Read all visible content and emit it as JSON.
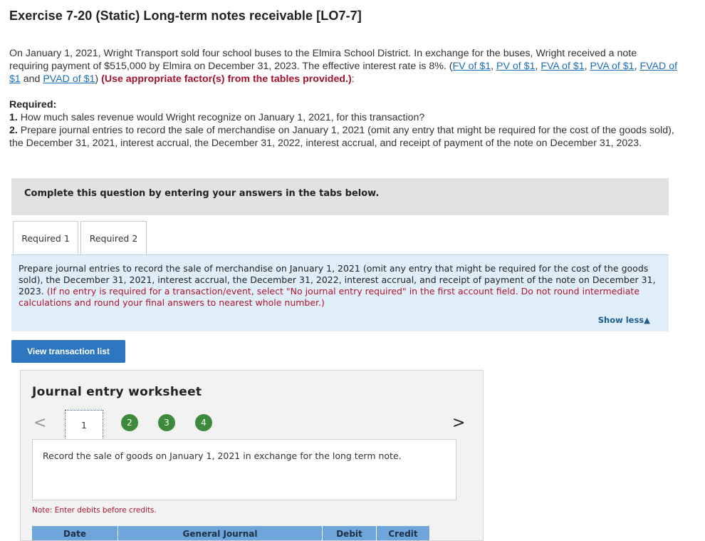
{
  "title": "Exercise 7-20 (Static) Long-term notes receivable [LO7-7]",
  "intro": {
    "text": "On January 1, 2021, Wright Transport sold four school buses to the Elmira School District. In exchange for the buses, Wright received a note requiring payment of $515,000 by Elmira on December 31, 2023. The effective interest rate is 8%. (",
    "links": [
      "FV of $1",
      "PV of $1",
      "FVA of $1",
      "PVA of $1",
      "FVAD of $1",
      "PVAD of $1"
    ],
    "sep_comma": ", ",
    "sep_and": " and ",
    "close_paren": ") ",
    "bold_red": "(Use appropriate factor(s) from the tables provided.)",
    "colon": ":"
  },
  "required": {
    "heading": "Required:",
    "item1_num": "1.",
    "item1": " How much sales revenue would Wright recognize on January 1, 2021, for this transaction?",
    "item2_num": "2.",
    "item2": " Prepare journal entries to record the sale of merchandise on January 1, 2021 (omit any entry that might be required for the cost of the goods sold), the December 31, 2021, interest accrual, the December 31, 2022, interest accrual, and receipt of payment of the note on December 31, 2023."
  },
  "banner": "Complete this question by entering your answers in the tabs below.",
  "tabs": [
    {
      "label": "Required 1"
    },
    {
      "label": "Required 2"
    }
  ],
  "instructions": {
    "text": "Prepare journal entries to record the sale of merchandise on January 1, 2021 (omit any entry that might be required for the cost of the goods sold), the December 31, 2021, interest accrual, the December 31, 2022, interest accrual, and receipt of payment of the note on December 31, 2023. ",
    "red": "(If no entry is required for a transaction/event, select \"No journal entry required\" in the first account field. Do not round intermediate calculations and round your final answers to nearest whole number.)",
    "show_less": "Show less▲"
  },
  "view_button": "View transaction list",
  "worksheet": {
    "title": "Journal entry worksheet",
    "prev": "<",
    "next": ">",
    "steps": [
      "1",
      "2",
      "3",
      "4"
    ],
    "record_text": "Record the sale of goods on January 1, 2021 in exchange for the long term note.",
    "note": "Note: Enter debits before credits.",
    "columns": [
      "Date",
      "General Journal",
      "Debit",
      "Credit"
    ]
  },
  "colors": {
    "link": "#1b6fb8",
    "red": "#a3122e",
    "button": "#2c77bf",
    "step_green": "#3c8a3c",
    "table_header": "#6ea6dc",
    "instructions_bg": "#dfeef9"
  }
}
